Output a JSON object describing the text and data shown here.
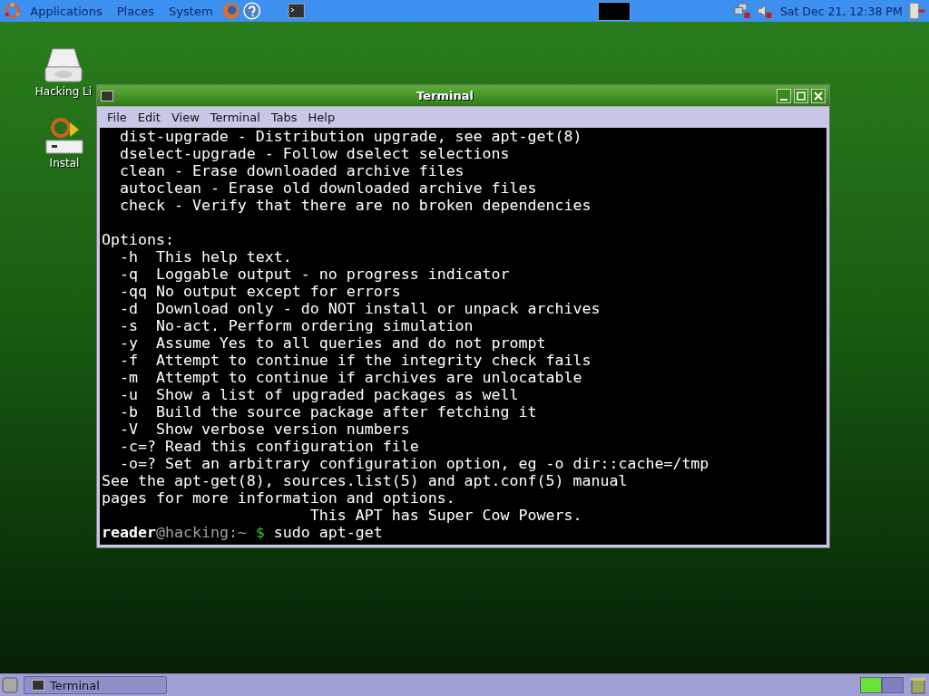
{
  "top_panel": {
    "menus": [
      "Applications",
      "Places",
      "System"
    ],
    "clock": "Sat Dec 21, 12:38 PM"
  },
  "desktop_icons": [
    {
      "label": "Hacking Li",
      "kind": "drive"
    },
    {
      "label": "Instal",
      "kind": "installer"
    }
  ],
  "window": {
    "title": "Terminal",
    "menu": [
      "File",
      "Edit",
      "View",
      "Terminal",
      "Tabs",
      "Help"
    ],
    "blocks": [
      [
        "  dist-upgrade - Distribution upgrade, see apt-get(8)",
        "  dselect-upgrade - Follow dselect selections",
        "  clean - Erase downloaded archive files",
        "  autoclean - Erase old downloaded archive files",
        "  check - Verify that there are no broken dependencies"
      ],
      [
        "Options:",
        "  -h  This help text.",
        "  -q  Loggable output - no progress indicator",
        "  -qq No output except for errors",
        "  -d  Download only - do NOT install or unpack archives",
        "  -s  No-act. Perform ordering simulation",
        "  -y  Assume Yes to all queries and do not prompt",
        "  -f  Attempt to continue if the integrity check fails",
        "  -m  Attempt to continue if archives are unlocatable",
        "  -u  Show a list of upgraded packages as well",
        "  -b  Build the source package after fetching it",
        "  -V  Show verbose version numbers",
        "  -c=? Read this configuration file",
        "  -o=? Set an arbitrary configuration option, eg -o dir::cache=/tmp",
        "See the apt-get(8), sources.list(5) and apt.conf(5) manual",
        "pages for more information and options.",
        "                       This APT has Super Cow Powers."
      ]
    ],
    "prompt": {
      "user": "reader",
      "host": "@hacking:~",
      "symbol": "$",
      "command": " sudo apt-get"
    }
  },
  "taskbar": {
    "tasks": [
      {
        "label": "Terminal",
        "selected": false
      }
    ],
    "workspaces": [
      {
        "selected": true
      },
      {
        "selected": false
      }
    ]
  }
}
